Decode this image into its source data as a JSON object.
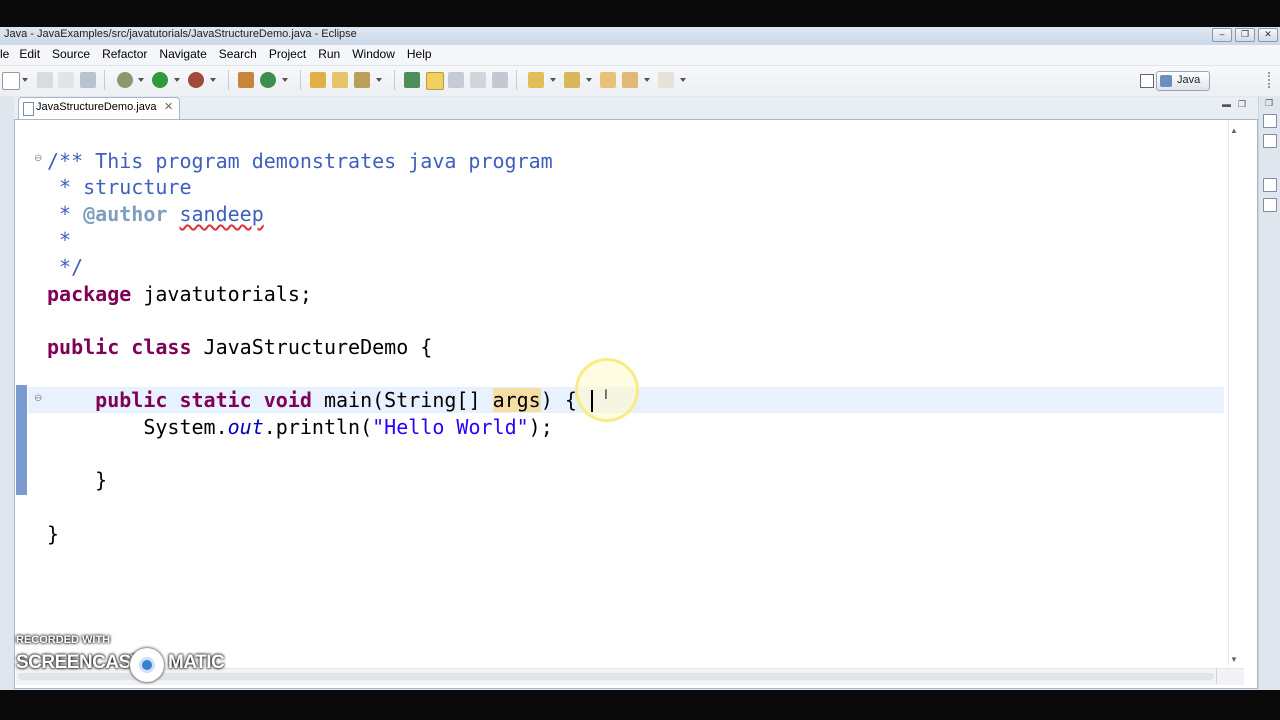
{
  "window": {
    "title": "Java - JavaExamples/src/javatutorials/JavaStructureDemo.java - Eclipse"
  },
  "menu": [
    "le",
    "Edit",
    "Source",
    "Refactor",
    "Navigate",
    "Search",
    "Project",
    "Run",
    "Window",
    "Help"
  ],
  "perspective": {
    "label": "Java"
  },
  "editor": {
    "tab_label": "JavaStructureDemo.java",
    "tab_close": "✕"
  },
  "code": {
    "l1": "/** This program demonstrates java program",
    "l2": " * structure",
    "l3a": " * ",
    "l3_tag": "@author",
    "l3_sp": " ",
    "l3_name": "sandeep",
    "l4": " *",
    "l5": " */",
    "l6_kw": "package",
    "l6_rest": " javatutorials;",
    "l8_kw1": "public",
    "l8_sp": " ",
    "l8_kw2": "class",
    "l8_rest": " JavaStructureDemo {",
    "l10_indent": "    ",
    "l10_kw1": "public",
    "l10_kw2": "static",
    "l10_kw3": "void",
    "l10_mid": " main(String[] ",
    "l10_args": "args",
    "l10_end": ") {",
    "l11_a": "        System.",
    "l11_out": "out",
    "l11_b": ".println(",
    "l11_str": "\"Hello World\"",
    "l11_c": ");",
    "l13": "    }",
    "l15": "}"
  },
  "watermark": {
    "top": "RECORDED WITH",
    "left": "SCREENCAST",
    "right": "MATIC"
  }
}
